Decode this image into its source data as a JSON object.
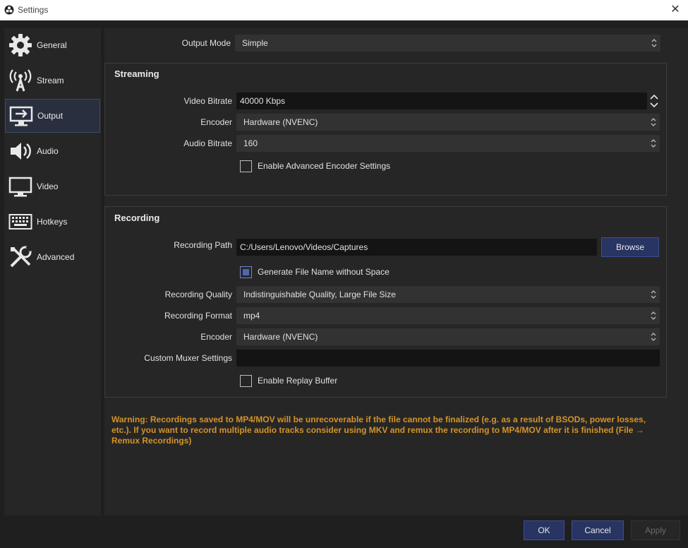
{
  "window": {
    "title": "Settings"
  },
  "sidebar": {
    "items": [
      {
        "label": "General",
        "icon": "gear-icon"
      },
      {
        "label": "Stream",
        "icon": "antenna-icon"
      },
      {
        "label": "Output",
        "icon": "output-icon",
        "active": true
      },
      {
        "label": "Audio",
        "icon": "speaker-icon"
      },
      {
        "label": "Video",
        "icon": "monitor-icon"
      },
      {
        "label": "Hotkeys",
        "icon": "keyboard-icon"
      },
      {
        "label": "Advanced",
        "icon": "tools-icon"
      }
    ]
  },
  "output_mode": {
    "label": "Output Mode",
    "value": "Simple"
  },
  "streaming": {
    "title": "Streaming",
    "video_bitrate": {
      "label": "Video Bitrate",
      "value": "40000 Kbps"
    },
    "encoder": {
      "label": "Encoder",
      "value": "Hardware (NVENC)"
    },
    "audio_bitrate": {
      "label": "Audio Bitrate",
      "value": "160"
    },
    "advanced_encoder": {
      "label": "Enable Advanced Encoder Settings",
      "checked": false
    }
  },
  "recording": {
    "title": "Recording",
    "path": {
      "label": "Recording Path",
      "value": "C:/Users/Lenovo/Videos/Captures",
      "browse_label": "Browse"
    },
    "no_space": {
      "label": "Generate File Name without Space",
      "checked": true
    },
    "quality": {
      "label": "Recording Quality",
      "value": "Indistinguishable Quality, Large File Size"
    },
    "format": {
      "label": "Recording Format",
      "value": "mp4"
    },
    "encoder": {
      "label": "Encoder",
      "value": "Hardware (NVENC)"
    },
    "muxer": {
      "label": "Custom Muxer Settings",
      "value": ""
    },
    "replay_buffer": {
      "label": "Enable Replay Buffer",
      "checked": false
    }
  },
  "warning": "Warning: Recordings saved to MP4/MOV will be unrecoverable if the file cannot be finalized (e.g. as a result of BSODs, power losses, etc.). If you want to record multiple audio tracks consider using MKV and remux the recording to MP4/MOV after it is finished (File → Remux Recordings)",
  "footer": {
    "ok": "OK",
    "cancel": "Cancel",
    "apply": "Apply"
  },
  "colors": {
    "accent": "#283461",
    "warning": "#d4932a",
    "background": "#1f1f1f",
    "panel": "#262626"
  }
}
